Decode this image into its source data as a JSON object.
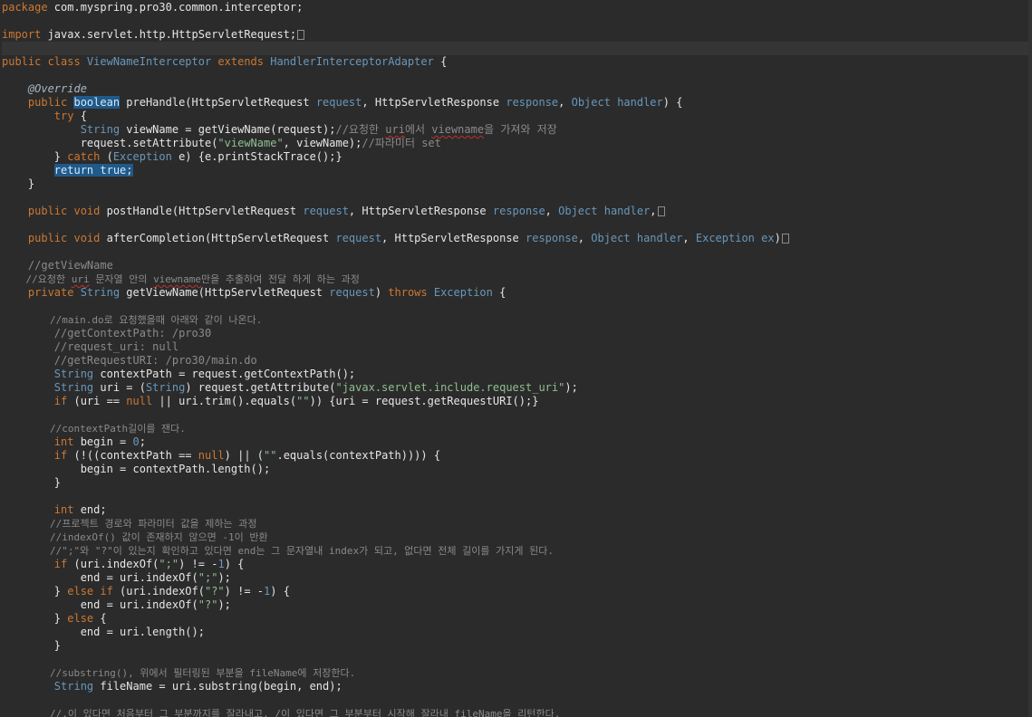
{
  "editor": {
    "colors": {
      "background": "#2b2b2b",
      "current_line": "#353535",
      "keyword": "#cc7832",
      "type": "#6897bb",
      "string": "#8fbf8f",
      "comment": "#8a8a8a",
      "text": "#e6e6e6",
      "selection": "#1f5a8a"
    },
    "lines": [
      {
        "row": 0,
        "tokens": [
          [
            "k-kw",
            "package"
          ],
          [
            "k-txt",
            " com.myspring.pro30.common.interceptor;"
          ]
        ]
      },
      {
        "row": 2,
        "fold": true,
        "tokens": [
          [
            "k-kw",
            "import"
          ],
          [
            "k-txt",
            " javax.servlet.http.HttpServletRequest;"
          ]
        ]
      },
      {
        "row": 3,
        "current": true,
        "tokens": []
      },
      {
        "row": 4,
        "tokens": [
          [
            "k-kw",
            "public class "
          ],
          [
            "k-type",
            "ViewNameInterceptor "
          ],
          [
            "k-kw",
            "extends "
          ],
          [
            "k-type",
            "HandlerInterceptorAdapter"
          ],
          [
            "k-txt",
            " {"
          ]
        ]
      },
      {
        "row": 6,
        "tokens": [
          [
            "k-ann",
            "    @Override"
          ]
        ]
      },
      {
        "row": 7,
        "tokens": [
          [
            "k-kw",
            "    public "
          ],
          [
            "k-sel",
            "boolean"
          ],
          [
            "k-txt",
            " preHandle(HttpServletRequest "
          ],
          [
            "k-type",
            "request"
          ],
          [
            "k-txt",
            ", HttpServletResponse "
          ],
          [
            "k-type",
            "response"
          ],
          [
            "k-txt",
            ", "
          ],
          [
            "k-type",
            "Object"
          ],
          [
            "k-txt",
            " "
          ],
          [
            "k-type",
            "handler"
          ],
          [
            "k-txt",
            ") {"
          ]
        ]
      },
      {
        "row": 8,
        "tokens": [
          [
            "k-kw",
            "        try"
          ],
          [
            "k-txt",
            " {"
          ]
        ]
      },
      {
        "row": 9,
        "tokens": [
          [
            "k-type",
            "            String"
          ],
          [
            "k-txt",
            " viewName = getViewName(request);"
          ],
          [
            "k-cmt",
            "//요청한 "
          ],
          [
            "k-cmt k-squig",
            "uri"
          ],
          [
            "k-cmt",
            "에서 "
          ],
          [
            "k-cmt k-squig",
            "viewname"
          ],
          [
            "k-cmt",
            "을 가져와 저장"
          ]
        ]
      },
      {
        "row": 10,
        "tokens": [
          [
            "k-txt",
            "            request.setAttribute("
          ],
          [
            "k-str",
            "\"viewName\""
          ],
          [
            "k-txt",
            ", viewName);"
          ],
          [
            "k-cmt",
            "//파라미터 set"
          ]
        ]
      },
      {
        "row": 11,
        "tokens": [
          [
            "k-txt",
            "        } "
          ],
          [
            "k-kw",
            "catch"
          ],
          [
            "k-txt",
            " ("
          ],
          [
            "k-type",
            "Exception"
          ],
          [
            "k-txt",
            " e) {e.printStackTrace();}"
          ]
        ]
      },
      {
        "row": 12,
        "tokens": [
          [
            "k-txt",
            "        "
          ],
          [
            "k-sel",
            "return true;"
          ]
        ]
      },
      {
        "row": 13,
        "tokens": [
          [
            "k-txt",
            "    }"
          ]
        ]
      },
      {
        "row": 15,
        "fold": true,
        "tokens": [
          [
            "k-kw",
            "    public void"
          ],
          [
            "k-txt",
            " postHandle(HttpServletRequest "
          ],
          [
            "k-type",
            "request"
          ],
          [
            "k-txt",
            ", HttpServletResponse "
          ],
          [
            "k-type",
            "response"
          ],
          [
            "k-txt",
            ", "
          ],
          [
            "k-type",
            "Object"
          ],
          [
            "k-txt",
            " "
          ],
          [
            "k-type",
            "handler"
          ],
          [
            "k-txt",
            ","
          ]
        ]
      },
      {
        "row": 17,
        "fold": true,
        "tokens": [
          [
            "k-kw",
            "    public void"
          ],
          [
            "k-txt",
            " afterCompletion(HttpServletRequest "
          ],
          [
            "k-type",
            "request"
          ],
          [
            "k-txt",
            ", HttpServletResponse "
          ],
          [
            "k-type",
            "response"
          ],
          [
            "k-txt",
            ", "
          ],
          [
            "k-type",
            "Object"
          ],
          [
            "k-txt",
            " "
          ],
          [
            "k-type",
            "handler"
          ],
          [
            "k-txt",
            ", "
          ],
          [
            "k-type",
            "Exception"
          ],
          [
            "k-txt",
            " "
          ],
          [
            "k-type",
            "ex"
          ],
          [
            "k-txt",
            ")"
          ]
        ]
      },
      {
        "row": 19,
        "tokens": [
          [
            "k-cmt",
            "    //getViewName"
          ]
        ]
      },
      {
        "row": 20,
        "comment": true,
        "tokens": [
          [
            "k-cmt",
            "    //요청한 "
          ],
          [
            "k-cmt k-squig",
            "uri"
          ],
          [
            "k-cmt",
            " 문자열 안의 "
          ],
          [
            "k-cmt k-squig",
            "viewname"
          ],
          [
            "k-cmt",
            "만을 추출하여 전달 하게 하는 과정"
          ]
        ]
      },
      {
        "row": 21,
        "tokens": [
          [
            "k-kw",
            "    private "
          ],
          [
            "k-type",
            "String"
          ],
          [
            "k-txt",
            " getViewName(HttpServletRequest "
          ],
          [
            "k-type",
            "request"
          ],
          [
            "k-txt",
            ") "
          ],
          [
            "k-kw",
            "throws "
          ],
          [
            "k-type",
            "Exception"
          ],
          [
            "k-txt",
            " {"
          ]
        ]
      },
      {
        "row": 23,
        "comment": true,
        "tokens": [
          [
            "k-cmt",
            "        //main.do로 요청했을때 아래와 같이 나온다."
          ]
        ]
      },
      {
        "row": 24,
        "tokens": [
          [
            "k-cmt",
            "        //getContextPath: /pro30"
          ]
        ]
      },
      {
        "row": 25,
        "tokens": [
          [
            "k-cmt",
            "        //request_uri: null"
          ]
        ]
      },
      {
        "row": 26,
        "tokens": [
          [
            "k-cmt",
            "        //getRequestURI: /pro30/main.do"
          ]
        ]
      },
      {
        "row": 27,
        "tokens": [
          [
            "k-type",
            "        String"
          ],
          [
            "k-txt",
            " contextPath = request.getContextPath();"
          ]
        ]
      },
      {
        "row": 28,
        "tokens": [
          [
            "k-type",
            "        String"
          ],
          [
            "k-txt",
            " uri = ("
          ],
          [
            "k-type",
            "String"
          ],
          [
            "k-txt",
            ") request.getAttribute("
          ],
          [
            "k-str",
            "\"javax.servlet.include.request_uri\""
          ],
          [
            "k-txt",
            ");"
          ]
        ]
      },
      {
        "row": 29,
        "tokens": [
          [
            "k-kw",
            "        if"
          ],
          [
            "k-txt",
            " (uri == "
          ],
          [
            "k-kw",
            "null"
          ],
          [
            "k-txt",
            " || uri.trim().equals("
          ],
          [
            "k-str",
            "\"\""
          ],
          [
            "k-txt",
            ")) {uri = request.getRequestURI();}"
          ]
        ]
      },
      {
        "row": 31,
        "comment": true,
        "tokens": [
          [
            "k-cmt",
            "        //contextPath길이를 잰다."
          ]
        ]
      },
      {
        "row": 32,
        "tokens": [
          [
            "k-kw",
            "        int"
          ],
          [
            "k-txt",
            " begin = "
          ],
          [
            "k-num",
            "0"
          ],
          [
            "k-txt",
            ";"
          ]
        ]
      },
      {
        "row": 33,
        "tokens": [
          [
            "k-kw",
            "        if"
          ],
          [
            "k-txt",
            " (!((contextPath == "
          ],
          [
            "k-kw",
            "null"
          ],
          [
            "k-txt",
            ") || ("
          ],
          [
            "k-str",
            "\"\""
          ],
          [
            "k-txt",
            ".equals(contextPath)))) {"
          ]
        ]
      },
      {
        "row": 34,
        "tokens": [
          [
            "k-txt",
            "            begin = contextPath.length();"
          ]
        ]
      },
      {
        "row": 35,
        "tokens": [
          [
            "k-txt",
            "        }"
          ]
        ]
      },
      {
        "row": 37,
        "tokens": [
          [
            "k-kw",
            "        int"
          ],
          [
            "k-txt",
            " end;"
          ]
        ]
      },
      {
        "row": 38,
        "comment": true,
        "tokens": [
          [
            "k-cmt",
            "        //프로젝트 경로와 파라미터 값을 제하는 과정"
          ]
        ]
      },
      {
        "row": 39,
        "comment": true,
        "tokens": [
          [
            "k-cmt",
            "        //indexOf() 값이 존재하지 않으면 -1이 반환"
          ]
        ]
      },
      {
        "row": 40,
        "comment": true,
        "tokens": [
          [
            "k-cmt",
            "        //\";\"와 \"?\"이 있는지 확인하고 있다면 end는 그 문자열내 index가 되고, 없다면 전체 길이를 가지게 된다."
          ]
        ]
      },
      {
        "row": 41,
        "tokens": [
          [
            "k-kw",
            "        if"
          ],
          [
            "k-txt",
            " (uri.indexOf("
          ],
          [
            "k-str",
            "\";\""
          ],
          [
            "k-txt",
            ") != -"
          ],
          [
            "k-num",
            "1"
          ],
          [
            "k-txt",
            ") {"
          ]
        ]
      },
      {
        "row": 42,
        "tokens": [
          [
            "k-txt",
            "            end = uri.indexOf("
          ],
          [
            "k-str",
            "\";\""
          ],
          [
            "k-txt",
            ");"
          ]
        ]
      },
      {
        "row": 43,
        "tokens": [
          [
            "k-txt",
            "        } "
          ],
          [
            "k-kw",
            "else if"
          ],
          [
            "k-txt",
            " (uri.indexOf("
          ],
          [
            "k-str",
            "\"?\""
          ],
          [
            "k-txt",
            ") != -"
          ],
          [
            "k-num",
            "1"
          ],
          [
            "k-txt",
            ") {"
          ]
        ]
      },
      {
        "row": 44,
        "tokens": [
          [
            "k-txt",
            "            end = uri.indexOf("
          ],
          [
            "k-str",
            "\"?\""
          ],
          [
            "k-txt",
            ");"
          ]
        ]
      },
      {
        "row": 45,
        "tokens": [
          [
            "k-txt",
            "        } "
          ],
          [
            "k-kw",
            "else"
          ],
          [
            "k-txt",
            " {"
          ]
        ]
      },
      {
        "row": 46,
        "tokens": [
          [
            "k-txt",
            "            end = uri.length();"
          ]
        ]
      },
      {
        "row": 47,
        "tokens": [
          [
            "k-txt",
            "        }"
          ]
        ]
      },
      {
        "row": 49,
        "comment": true,
        "tokens": [
          [
            "k-cmt",
            "        //substring(), 위에서 필터링된 부분을 fileName에 저장한다."
          ]
        ]
      },
      {
        "row": 50,
        "tokens": [
          [
            "k-type",
            "        String"
          ],
          [
            "k-txt",
            " fileName = uri.substring(begin, end);"
          ]
        ]
      },
      {
        "row": 52,
        "comment": true,
        "tokens": [
          [
            "k-cmt",
            "        //.이 있다면 처음부터 그 부분까지를 잘라내고, /이 있다면 그 부분부터 시작해 잘라내 fileName을 리턴한다."
          ]
        ]
      }
    ]
  }
}
